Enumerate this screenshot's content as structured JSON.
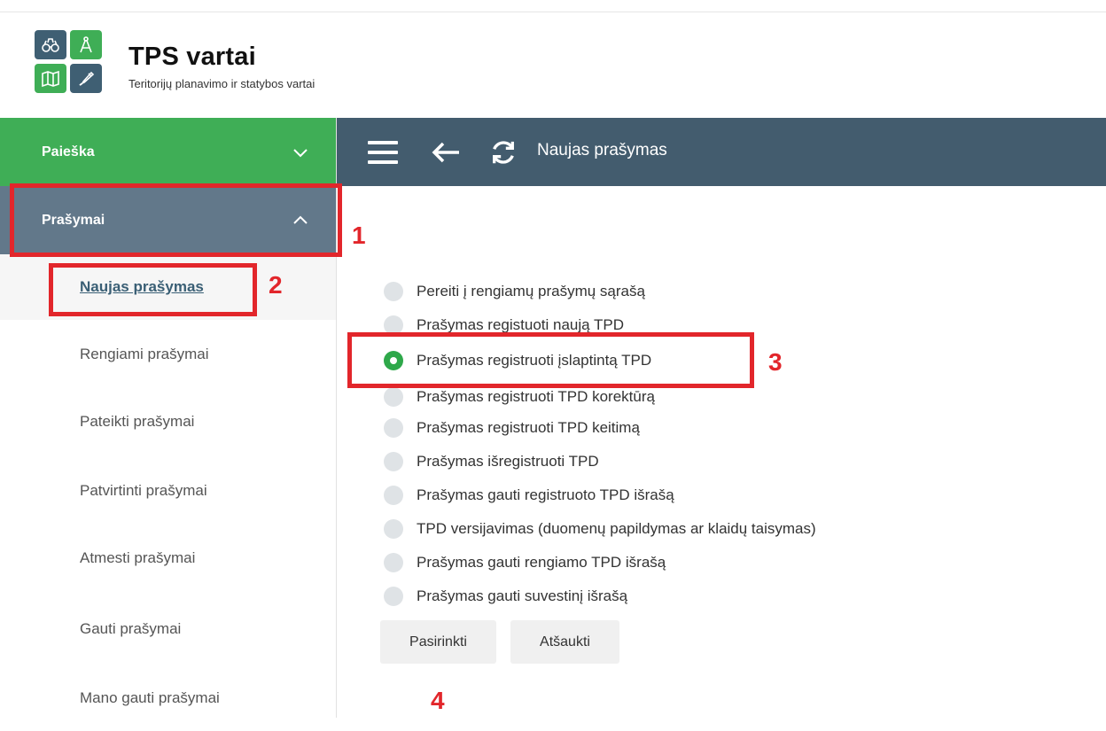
{
  "brand": {
    "title": "TPS vartai",
    "subtitle": "Teritorijų planavimo ir statybos vartai",
    "colors": {
      "green": "#3fae56",
      "slate": "#3f5f73"
    },
    "logo_icons": [
      "binoculars-icon",
      "compass-icon",
      "map-icon",
      "pencil-icon"
    ]
  },
  "sidebar": {
    "search_label": "Paieška",
    "requests_label": "Prašymai",
    "items": [
      {
        "label": "Naujas prašymas",
        "active": true
      },
      {
        "label": "Rengiami prašymai"
      },
      {
        "label": "Pateikti prašymai"
      },
      {
        "label": "Patvirtinti prašymai"
      },
      {
        "label": "Atmesti prašymai"
      },
      {
        "label": "Gauti prašymai"
      },
      {
        "label": "Mano gauti prašymai"
      }
    ]
  },
  "topbar": {
    "title": "Naujas prašymas",
    "background": "#435c6e"
  },
  "options": [
    {
      "label": "Pereiti į rengiamų prašymų sąrašą",
      "selected": false
    },
    {
      "label": "Prašymas registuoti naują TPD",
      "selected": false
    },
    {
      "label": "Prašymas registruoti įslaptintą TPD",
      "selected": true
    },
    {
      "label": "Prašymas registruoti TPD korektūrą",
      "selected": false
    },
    {
      "label": "Prašymas registruoti TPD keitimą",
      "selected": false
    },
    {
      "label": "Prašymas išregistruoti TPD",
      "selected": false
    },
    {
      "label": "Prašymas gauti registruoto TPD išrašą",
      "selected": false
    },
    {
      "label": "TPD versijavimas (duomenų papildymas ar klaidų taisymas)",
      "selected": false
    },
    {
      "label": "Prašymas gauti rengiamo TPD išrašą",
      "selected": false
    },
    {
      "label": "Prašymas gauti suvestinį išrašą",
      "selected": false
    }
  ],
  "buttons": {
    "select": "Pasirinkti",
    "cancel": "Atšaukti"
  },
  "annotations": [
    "1",
    "2",
    "3",
    "4"
  ]
}
